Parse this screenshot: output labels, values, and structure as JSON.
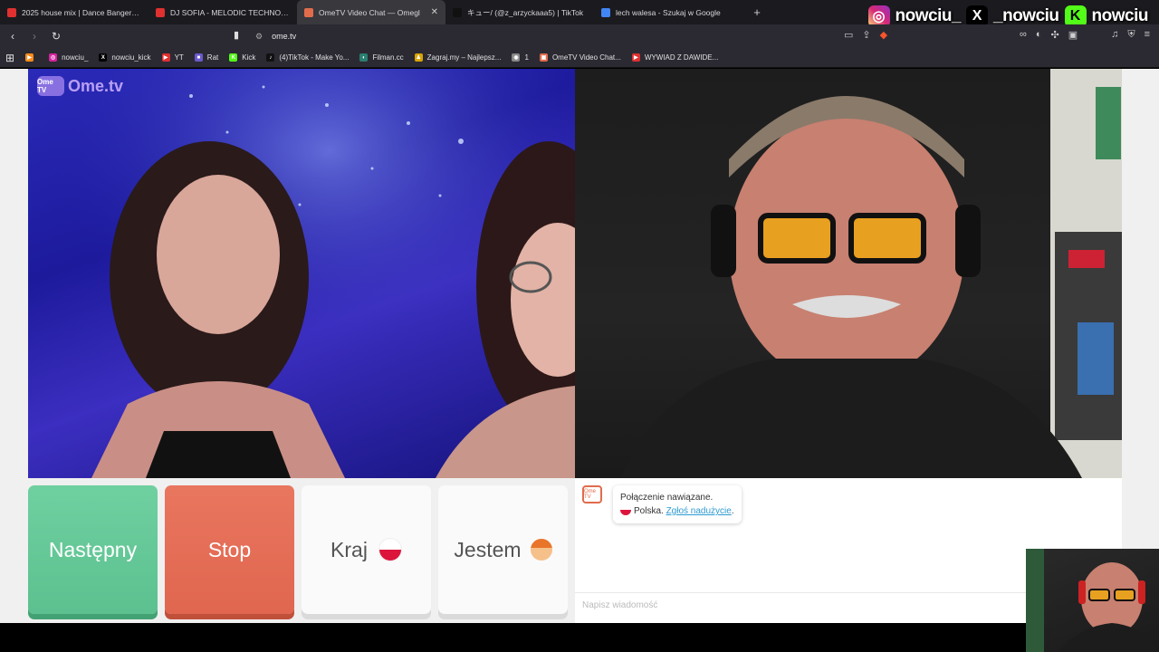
{
  "tabs": [
    {
      "title": "2025 house mix | Dance Bangers - Yo",
      "color": "#e03030",
      "active": false
    },
    {
      "title": "DJ SOFIA - MELODIC TECHNO & FU",
      "color": "#e03030",
      "active": false
    },
    {
      "title": "OmeTV Video Chat — Omegl",
      "color": "#e06c4c",
      "active": true
    },
    {
      "title": "キュー/ (@z_arzyckaaa5) | TikTok",
      "color": "#111111",
      "active": false
    },
    {
      "title": "lech walesa - Szukaj w Google",
      "color": "#4285f4",
      "active": false
    }
  ],
  "new_tab": "+",
  "social": [
    {
      "icon": "instagram-icon",
      "glyph": "◎",
      "color": "#d6249f",
      "name": "nowciu_"
    },
    {
      "icon": "x-icon",
      "glyph": "X",
      "color": "#000000",
      "name": "_nowciu"
    },
    {
      "icon": "kick-icon",
      "glyph": "K",
      "color": "#53fc18",
      "name": "nowciu"
    }
  ],
  "address": {
    "url": "ome.tv"
  },
  "bookmarks": [
    {
      "label": "",
      "color": "#ff8c1a",
      "glyph": "▶"
    },
    {
      "label": "nowciu_",
      "color": "#d6249f",
      "glyph": "◎"
    },
    {
      "label": "nowciu_kick",
      "color": "#000000",
      "glyph": "X"
    },
    {
      "label": "YT",
      "color": "#e03030",
      "glyph": "▶"
    },
    {
      "label": "Rat",
      "color": "#6a5acd",
      "glyph": "■"
    },
    {
      "label": "Kick",
      "color": "#53fc18",
      "glyph": "K"
    },
    {
      "label": "(4)TikTok - Make Yo...",
      "color": "#111111",
      "glyph": "♪"
    },
    {
      "label": "Filman.cc",
      "color": "#2a7f6f",
      "glyph": "◐"
    },
    {
      "label": "Zagraj.my – Najlepsz...",
      "color": "#d9a400",
      "glyph": "♟"
    },
    {
      "label": "1",
      "color": "#888888",
      "glyph": "◉"
    },
    {
      "label": "OmeTV Video Chat...",
      "color": "#e06c4c",
      "glyph": "▣"
    },
    {
      "label": "WYWIAD Z DAWIDE...",
      "color": "#e03030",
      "glyph": "▶"
    }
  ],
  "logo": {
    "box": "Ome TV",
    "text": "Ome.tv"
  },
  "buttons": {
    "next": "Następny",
    "stop": "Stop",
    "country": "Kraj",
    "gender": "Jestem"
  },
  "chat": {
    "icon": "Ome TV",
    "connected": "Połączenie nawiązane.",
    "country": "Polska.",
    "report": "Zgłoś nadużycie",
    "report_end": ".",
    "placeholder": "Napisz wiadomość"
  }
}
